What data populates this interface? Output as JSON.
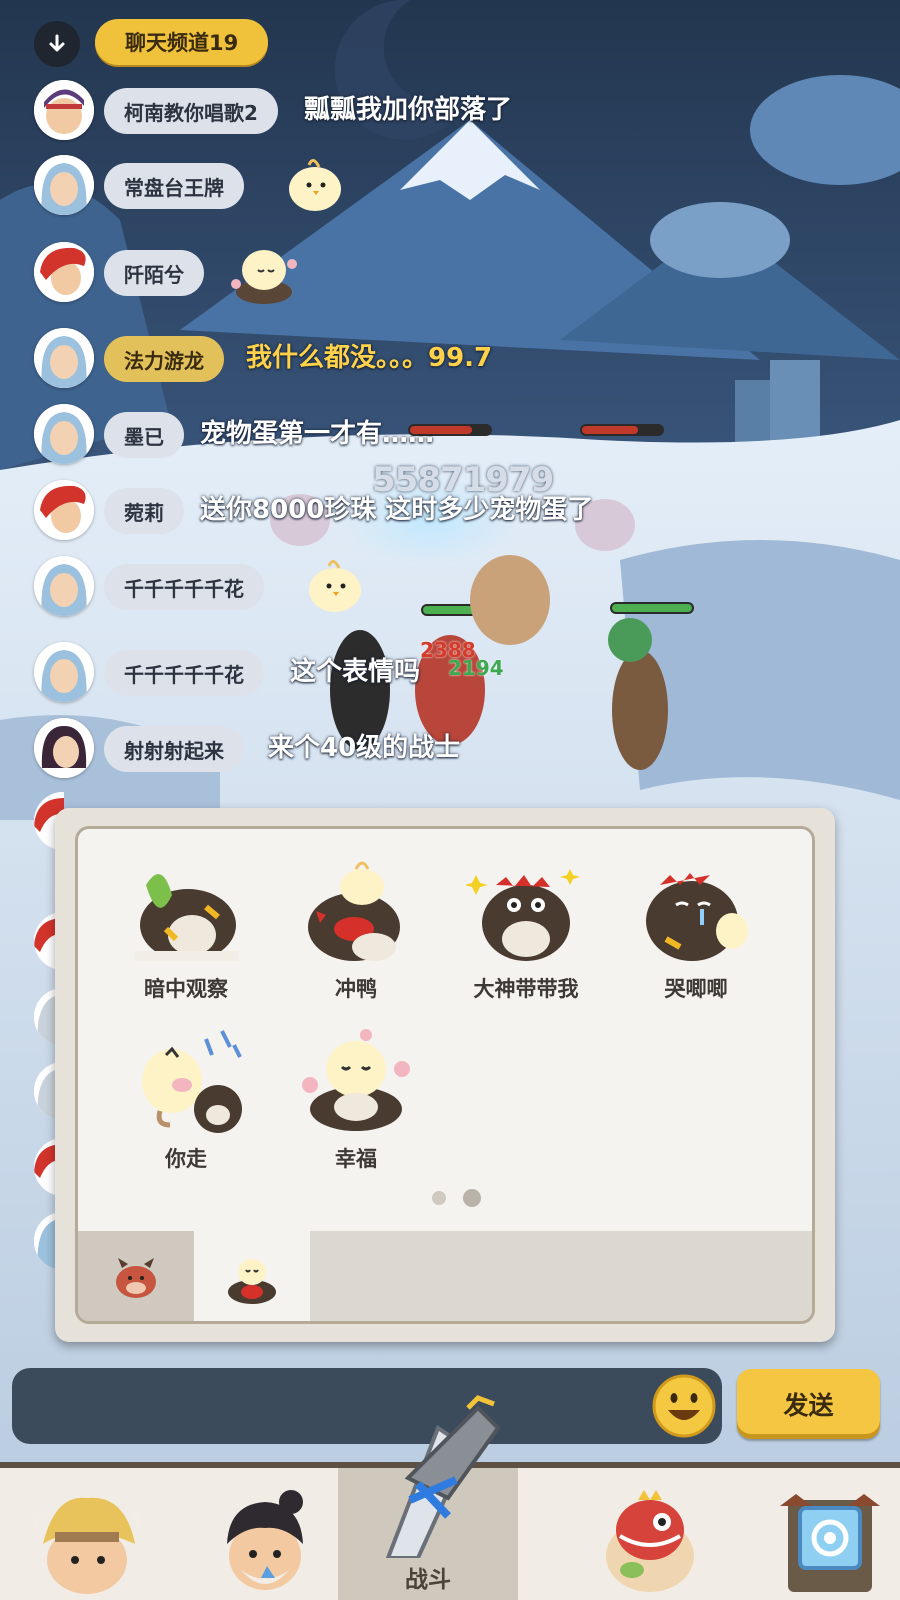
{
  "header": {
    "channel_label": "聊天频道19"
  },
  "chat": {
    "messages": [
      {
        "name": "柯南教你唱歌2",
        "text": "瓢瓢我加你部落了"
      },
      {
        "name": "常盘台王牌",
        "text": ""
      },
      {
        "name": "阡陌兮",
        "text": ""
      },
      {
        "name": "法力游龙",
        "text": "我什么都没。。。99.7"
      },
      {
        "name": "墨已",
        "text": "宠物蛋第一才有……"
      },
      {
        "name": "菀莉",
        "text": "送你8000珍珠 这时多少宠物蛋了"
      },
      {
        "name": "千千千千千花",
        "text": ""
      },
      {
        "name": "千千千千千花",
        "text": "这个表情吗"
      },
      {
        "name": "射射射起来",
        "text": "来个40级的战士"
      }
    ]
  },
  "battle": {
    "damage_numbers": [
      "55871979",
      "2388",
      "2194"
    ]
  },
  "emoji_panel": {
    "stickers": [
      {
        "label": "暗中观察",
        "icon": "dino-peek-sticker"
      },
      {
        "label": "冲鸭",
        "icon": "dino-charge-sticker"
      },
      {
        "label": "大神带带我",
        "icon": "dino-beg-sticker"
      },
      {
        "label": "哭唧唧",
        "icon": "dino-cry-sticker"
      },
      {
        "label": "你走",
        "icon": "chick-angry-sticker"
      },
      {
        "label": "幸福",
        "icon": "chick-happy-sticker"
      }
    ],
    "page_count": 2,
    "active_page": 2,
    "tabs": [
      {
        "icon": "boar-pack-icon",
        "active": false
      },
      {
        "icon": "chick-dino-pack-icon",
        "active": true
      }
    ]
  },
  "input": {
    "value": "",
    "emoji_button_icon": "smiley-face-icon",
    "send_label": "发送"
  },
  "bottom_nav": {
    "items": [
      {
        "icon": "hero-fur-hat-icon",
        "label": ""
      },
      {
        "icon": "hero-topknot-icon",
        "label": ""
      },
      {
        "icon": "battle-sword-icon",
        "label": "战斗",
        "active": true
      },
      {
        "icon": "pet-dino-icon",
        "label": ""
      },
      {
        "icon": "portal-gate-icon",
        "label": ""
      }
    ]
  },
  "colors": {
    "channel_badge": "#f0c23b",
    "name_pill": "#dde2ea",
    "highlight_text": "#ffd24a",
    "send_button": "#f4c641"
  }
}
